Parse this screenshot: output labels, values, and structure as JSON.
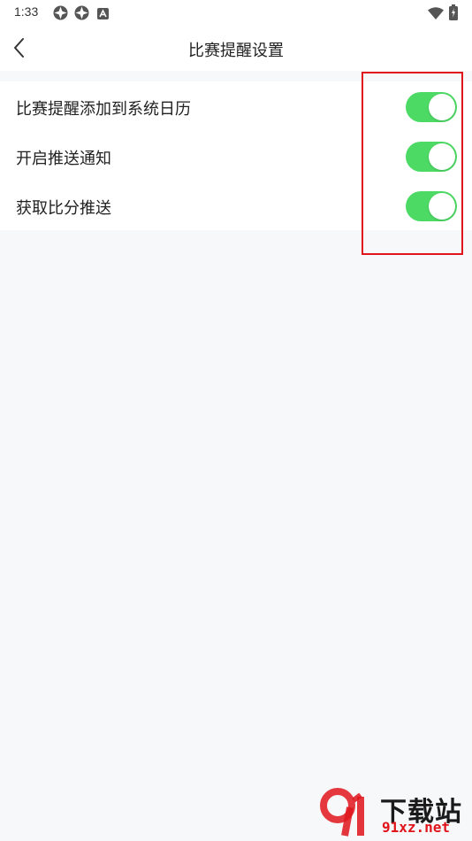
{
  "status_bar": {
    "time": "1:33",
    "icons": [
      "shutter-icon",
      "shutter-icon",
      "app-a-icon",
      "wifi-icon",
      "battery-charging-icon"
    ]
  },
  "header": {
    "title": "比赛提醒设置",
    "back_icon": "chevron-left-icon"
  },
  "settings": [
    {
      "label": "比赛提醒添加到系统日历",
      "enabled": true
    },
    {
      "label": "开启推送通知",
      "enabled": true
    },
    {
      "label": "获取比分推送",
      "enabled": true
    }
  ],
  "colors": {
    "toggle_on": "#4cd964",
    "highlight_border": "#e0151c",
    "background": "#f7f8fa"
  },
  "watermark": {
    "brand": "下载站",
    "url": "91xz.net"
  }
}
